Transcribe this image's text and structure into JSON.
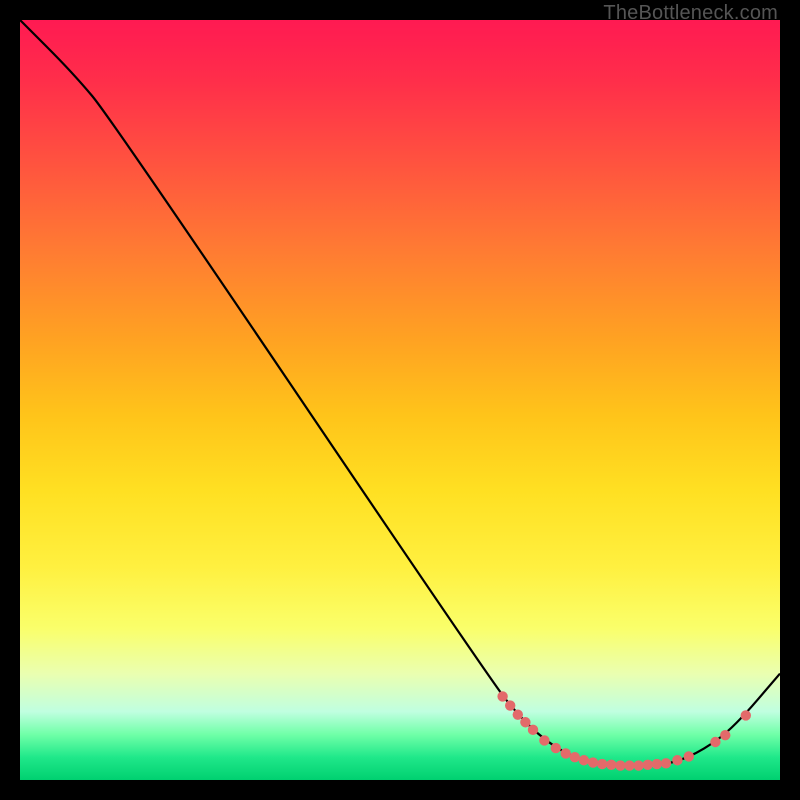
{
  "watermark": "TheBottleneck.com",
  "chart_data": {
    "type": "line",
    "title": "",
    "xlabel": "",
    "ylabel": "",
    "xlim": [
      0,
      100
    ],
    "ylim": [
      0,
      100
    ],
    "curve": [
      {
        "x": 0,
        "y": 100
      },
      {
        "x": 7,
        "y": 93
      },
      {
        "x": 12,
        "y": 87
      },
      {
        "x": 62,
        "y": 13
      },
      {
        "x": 66,
        "y": 8
      },
      {
        "x": 70,
        "y": 4.5
      },
      {
        "x": 74,
        "y": 2.5
      },
      {
        "x": 78,
        "y": 1.8
      },
      {
        "x": 82,
        "y": 1.8
      },
      {
        "x": 86,
        "y": 2.2
      },
      {
        "x": 90,
        "y": 4
      },
      {
        "x": 94,
        "y": 7
      },
      {
        "x": 100,
        "y": 14
      }
    ],
    "points": [
      {
        "x": 63.5,
        "y": 11.0
      },
      {
        "x": 64.5,
        "y": 9.8
      },
      {
        "x": 65.5,
        "y": 8.6
      },
      {
        "x": 66.5,
        "y": 7.6
      },
      {
        "x": 67.5,
        "y": 6.6
      },
      {
        "x": 69.0,
        "y": 5.2
      },
      {
        "x": 70.5,
        "y": 4.2
      },
      {
        "x": 71.8,
        "y": 3.5
      },
      {
        "x": 73.0,
        "y": 3.0
      },
      {
        "x": 74.2,
        "y": 2.6
      },
      {
        "x": 75.4,
        "y": 2.3
      },
      {
        "x": 76.6,
        "y": 2.1
      },
      {
        "x": 77.8,
        "y": 2.0
      },
      {
        "x": 79.0,
        "y": 1.9
      },
      {
        "x": 80.2,
        "y": 1.9
      },
      {
        "x": 81.4,
        "y": 1.9
      },
      {
        "x": 82.6,
        "y": 2.0
      },
      {
        "x": 83.8,
        "y": 2.1
      },
      {
        "x": 85.0,
        "y": 2.2
      },
      {
        "x": 86.5,
        "y": 2.6
      },
      {
        "x": 88.0,
        "y": 3.1
      },
      {
        "x": 91.5,
        "y": 5.0
      },
      {
        "x": 92.8,
        "y": 5.9
      },
      {
        "x": 95.5,
        "y": 8.5
      }
    ],
    "point_color": "#e36a6a",
    "line_color": "#000000"
  }
}
